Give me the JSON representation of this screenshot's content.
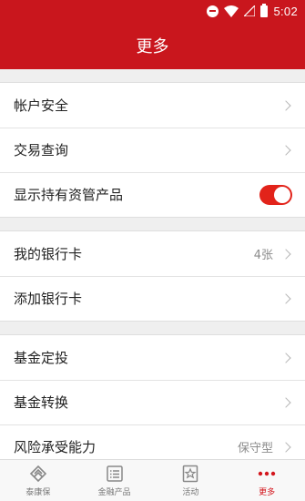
{
  "status_bar": {
    "time": "5:02"
  },
  "header": {
    "title": "更多"
  },
  "groups": [
    {
      "items": [
        {
          "label": "帐户安全"
        },
        {
          "label": "交易查询"
        },
        {
          "label": "显示持有资管产品",
          "toggle": true
        }
      ]
    },
    {
      "items": [
        {
          "label": "我的银行卡",
          "value": "4张"
        },
        {
          "label": "添加银行卡"
        }
      ]
    },
    {
      "items": [
        {
          "label": "基金定投"
        },
        {
          "label": "基金转换"
        },
        {
          "label": "风险承受能力",
          "value": "保守型"
        }
      ]
    }
  ],
  "tabbar": {
    "tabs": [
      {
        "label": "泰康保"
      },
      {
        "label": "金融产品"
      },
      {
        "label": "活动"
      },
      {
        "label": "更多"
      }
    ]
  },
  "colors": {
    "brand_red": "#c9161d",
    "toggle_on": "#e2231a"
  }
}
